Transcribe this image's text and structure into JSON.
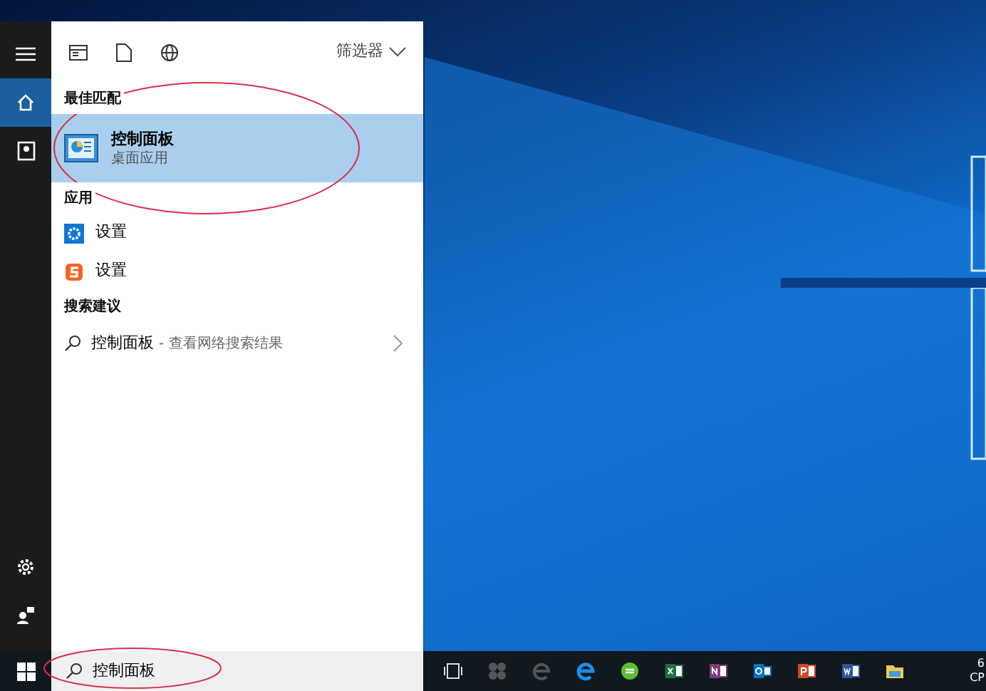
{
  "rail": {
    "items": [
      {
        "kind": "menu",
        "selected": false
      },
      {
        "kind": "home",
        "selected": true
      },
      {
        "kind": "notebook",
        "selected": false
      },
      {
        "kind": "settings",
        "selected": false
      },
      {
        "kind": "feedback",
        "selected": false
      }
    ]
  },
  "start_menu": {
    "filter_label": "筛选器",
    "sections": [
      {
        "heading": "最佳匹配",
        "items": [
          {
            "kind": "best",
            "title": "控制面板",
            "subtitle": "桌面应用",
            "selected": true
          }
        ]
      },
      {
        "heading": "应用",
        "items": [
          {
            "kind": "app",
            "title": "设置",
            "selected": false
          },
          {
            "kind": "app",
            "title": "设置",
            "selected": false
          }
        ]
      },
      {
        "heading": "搜索建议",
        "items": [
          {
            "kind": "suggestion",
            "title": "控制面板",
            "subtitle": "- 查看网络搜索结果",
            "selected": false
          }
        ]
      }
    ]
  },
  "taskbar": {
    "search_value": "控制面板",
    "tray": [
      "6",
      "CP"
    ]
  }
}
